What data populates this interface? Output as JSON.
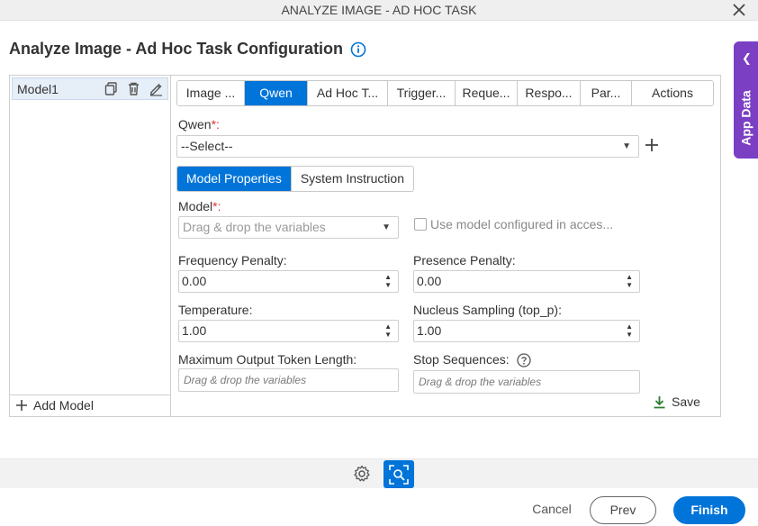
{
  "window": {
    "title": "ANALYZE IMAGE - AD HOC TASK"
  },
  "page": {
    "title": "Analyze Image - Ad Hoc Task Configuration"
  },
  "app_data": {
    "label": "App Data"
  },
  "left_panel": {
    "models": [
      {
        "label": "Model1"
      }
    ],
    "add_model_label": "Add Model"
  },
  "tabs": [
    {
      "label": "Image ...",
      "active": false
    },
    {
      "label": "Qwen",
      "active": true
    },
    {
      "label": "Ad Hoc T...",
      "active": false
    },
    {
      "label": "Trigger...",
      "active": false
    },
    {
      "label": "Reque...",
      "active": false
    },
    {
      "label": "Respo...",
      "active": false
    },
    {
      "label": "Par...",
      "active": false
    },
    {
      "label": "Actions",
      "active": false
    }
  ],
  "qwen": {
    "label": "Qwen",
    "required_mark": "*:",
    "selected": "--Select--"
  },
  "subtabs": [
    {
      "label": "Model Properties",
      "active": true
    },
    {
      "label": "System Instruction",
      "active": false
    }
  ],
  "form": {
    "model": {
      "label": "Model",
      "required_mark": "*:",
      "placeholder": "Drag & drop the variables"
    },
    "use_model_checkbox": {
      "label": "Use model configured in acces...",
      "checked": false
    },
    "frequency_penalty": {
      "label": "Frequency Penalty:",
      "value": "0.00"
    },
    "presence_penalty": {
      "label": "Presence Penalty:",
      "value": "0.00"
    },
    "temperature": {
      "label": "Temperature:",
      "value": "1.00"
    },
    "nucleus_sampling": {
      "label": "Nucleus Sampling (top_p):",
      "value": "1.00"
    },
    "max_output_tokens": {
      "label": "Maximum Output Token Length:",
      "placeholder": "Drag & drop the variables"
    },
    "stop_sequences": {
      "label": "Stop Sequences:",
      "placeholder": "Drag & drop the variables"
    },
    "save_label": "Save"
  },
  "footer": {
    "cancel_label": "Cancel",
    "prev_label": "Prev",
    "finish_label": "Finish"
  },
  "colors": {
    "accent": "#0074d9",
    "app_data_bg": "#7b3fc4",
    "save_icon": "#2e7d32"
  }
}
